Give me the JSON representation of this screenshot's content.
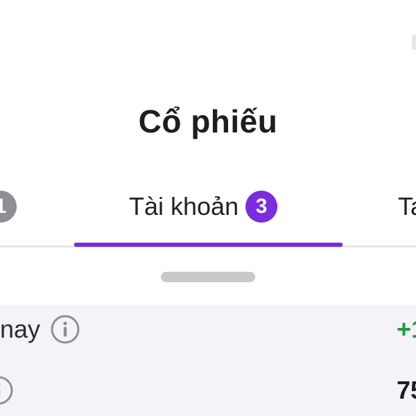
{
  "header": {
    "title": "Cổ phiếu"
  },
  "tabs": [
    {
      "label": "",
      "badge": "1",
      "active": false
    },
    {
      "label": "Tài khoản",
      "badge": "3",
      "active": true
    },
    {
      "label": "Ta",
      "badge": "",
      "active": false
    }
  ],
  "rows": [
    {
      "label": "nay",
      "value": "+1",
      "value_color": "#1f9d3a"
    },
    {
      "label": "",
      "value": "75",
      "value_color": "#1e1e20"
    }
  ],
  "colors": {
    "accent": "#7b2ce0",
    "badge_inactive": "#8e8e93",
    "positive": "#1f9d3a"
  },
  "icons": {
    "info": "info-circle-icon"
  }
}
